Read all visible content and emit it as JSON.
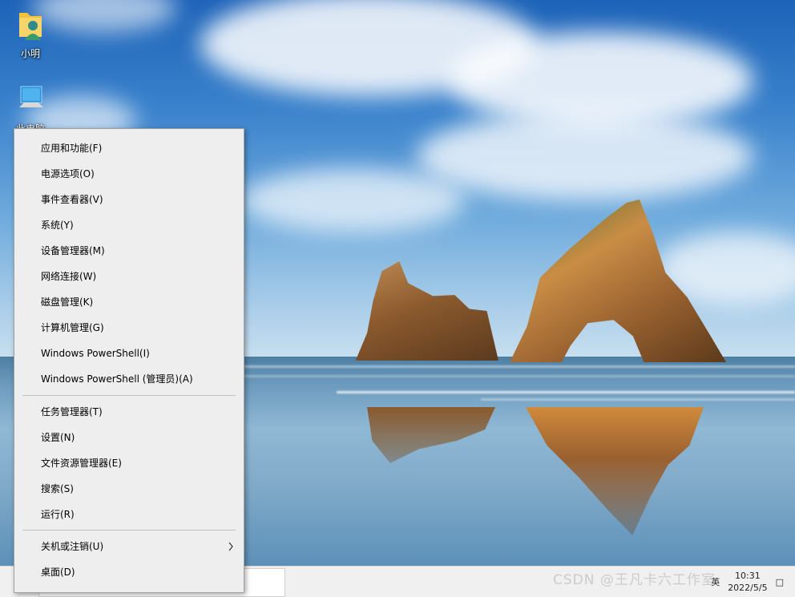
{
  "desktop": {
    "icons": [
      {
        "label": "小明",
        "icon": "user-folder-icon"
      },
      {
        "label": "此电脑",
        "icon": "this-pc-icon"
      }
    ]
  },
  "context_menu": {
    "groups": [
      [
        {
          "label": "应用和功能(F)"
        },
        {
          "label": "电源选项(O)"
        },
        {
          "label": "事件查看器(V)"
        },
        {
          "label": "系统(Y)"
        },
        {
          "label": "设备管理器(M)"
        },
        {
          "label": "网络连接(W)"
        },
        {
          "label": "磁盘管理(K)"
        },
        {
          "label": "计算机管理(G)"
        },
        {
          "label": "Windows PowerShell(I)"
        },
        {
          "label": "Windows PowerShell (管理员)(A)"
        }
      ],
      [
        {
          "label": "任务管理器(T)"
        },
        {
          "label": "设置(N)"
        },
        {
          "label": "文件资源管理器(E)"
        },
        {
          "label": "搜索(S)"
        },
        {
          "label": "运行(R)"
        }
      ],
      [
        {
          "label": "关机或注销(U)",
          "has_submenu": true
        },
        {
          "label": "桌面(D)"
        }
      ]
    ]
  },
  "taskbar": {
    "time": "10:31",
    "date": "2022/5/5",
    "input_method": "英"
  },
  "watermark": "CSDN @王凡卡六工作室"
}
